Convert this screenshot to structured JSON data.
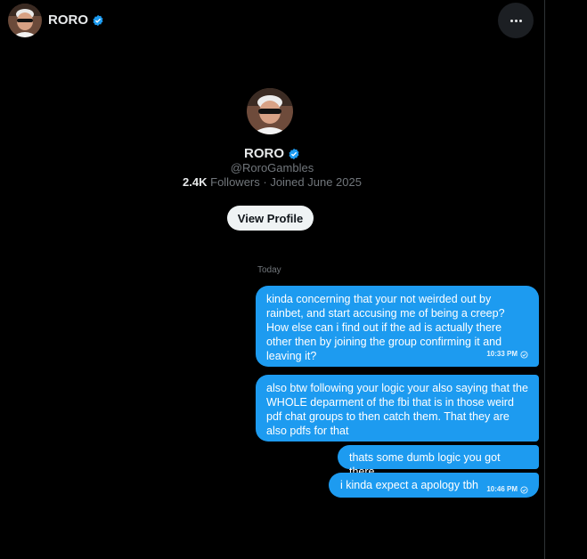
{
  "header": {
    "name": "RORO",
    "more_label": "More"
  },
  "profile": {
    "name": "RORO",
    "handle": "@RoroGambles",
    "followers_count": "2.4K",
    "followers_label": "Followers",
    "joined": "· Joined June 2025",
    "view_profile_label": "View Profile"
  },
  "conversation": {
    "date_separator": "Today",
    "messages": [
      {
        "text": "kinda concerning that your not weirded out by rainbet, and start accusing me of being a creep? How else can i find out if the ad is actually there other then by joining the group confirming it and leaving it?",
        "time": "10:33 PM"
      },
      {
        "text": "also btw following your logic your also saying that the WHOLE deparment of the fbi that is in those weird pdf chat groups to then catch them. That they are also pdfs for that",
        "time": ""
      },
      {
        "text": "thats some dumb logic you got there",
        "time": ""
      },
      {
        "text": "i kinda expect a apology tbh",
        "time": "10:46 PM"
      }
    ]
  },
  "colors": {
    "background": "#000000",
    "bubble": "#1d9bf0",
    "verified": "#1d9bf0",
    "muted_text": "#71767b",
    "primary_text": "#e7e9ea"
  },
  "icons": {
    "verified": "verified-badge-icon",
    "more": "more-horizontal-icon",
    "read": "read-check-icon"
  }
}
